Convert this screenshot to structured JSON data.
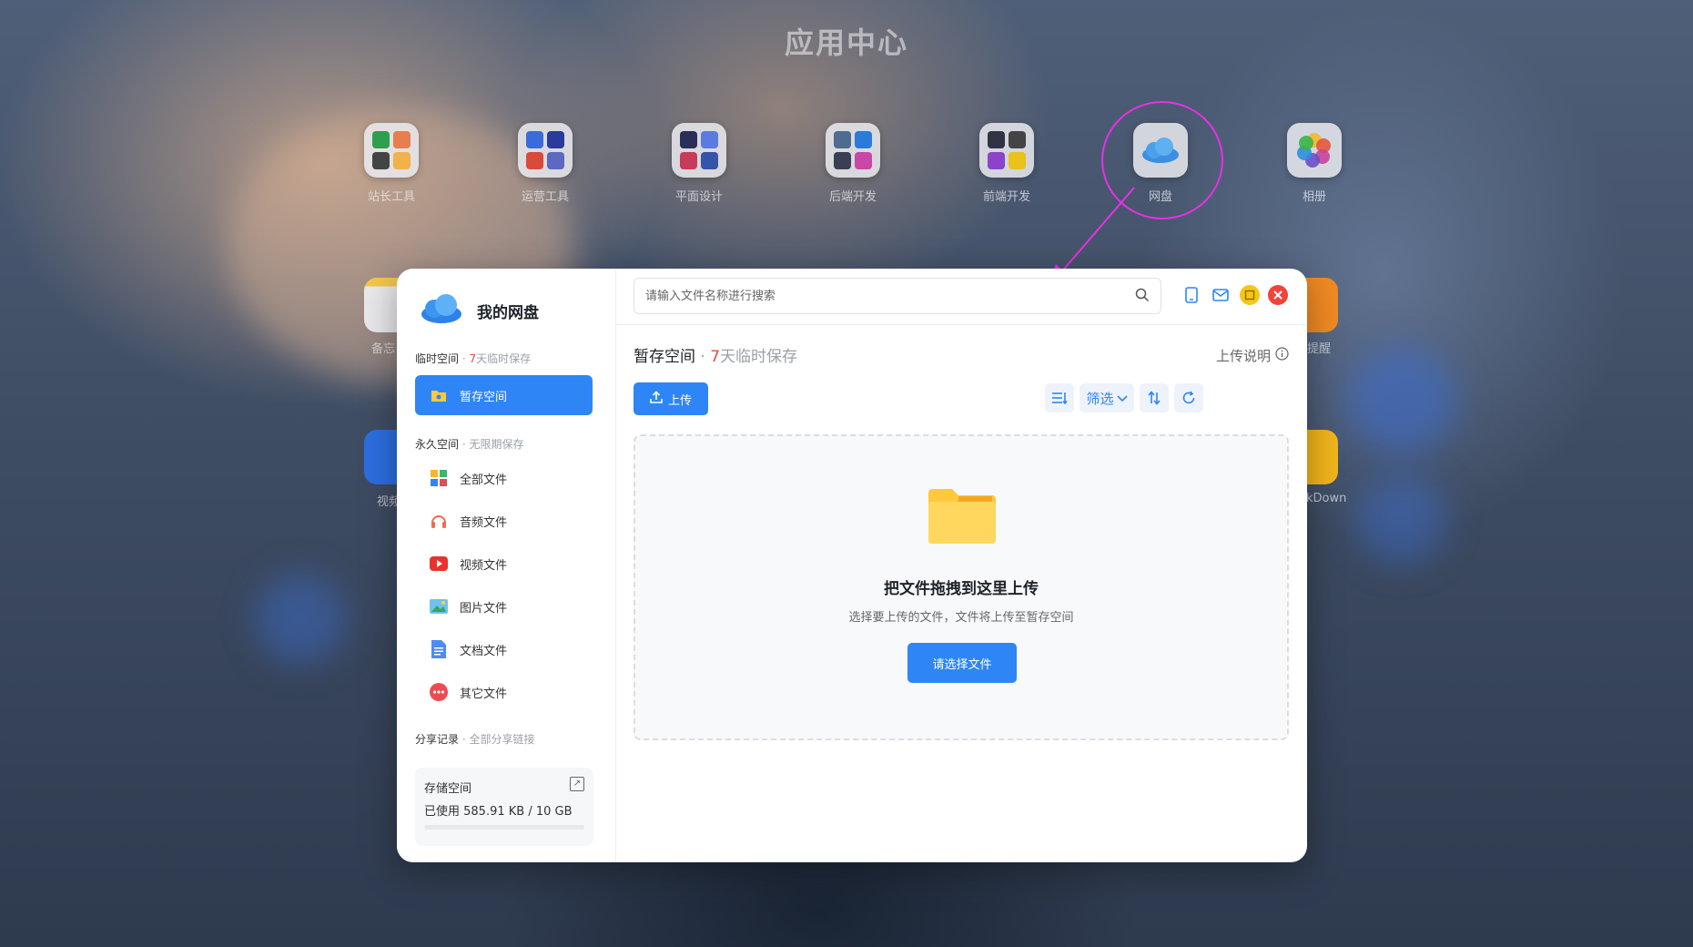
{
  "app_center": {
    "title": "应用中心",
    "apps": [
      {
        "label": "站长工具",
        "icon": "webmaster-tools-icon"
      },
      {
        "label": "运营工具",
        "icon": "operations-tools-icon"
      },
      {
        "label": "平面设计",
        "icon": "graphic-design-icon"
      },
      {
        "label": "后端开发",
        "icon": "backend-dev-icon"
      },
      {
        "label": "前端开发",
        "icon": "frontend-dev-icon"
      },
      {
        "label": "网盘",
        "icon": "cloud-drive-icon"
      },
      {
        "label": "相册",
        "icon": "photos-icon"
      }
    ],
    "partial_labels": [
      "备忘",
      "提醒",
      "视频",
      "kDown"
    ]
  },
  "sidebar": {
    "title": "我的网盘",
    "temp_section": {
      "label": "临时空间",
      "sep": " · ",
      "accent": "7",
      "sub": "天临时保存"
    },
    "active_item": {
      "label": "暂存空间",
      "icon": "folder-icon"
    },
    "perm_section": {
      "label": "永久空间",
      "sep": " · ",
      "sub": "无限期保存"
    },
    "items": [
      {
        "label": "全部文件",
        "icon": "grid-icon"
      },
      {
        "label": "音频文件",
        "icon": "headphones-icon"
      },
      {
        "label": "视频文件",
        "icon": "play-icon"
      },
      {
        "label": "图片文件",
        "icon": "image-icon"
      },
      {
        "label": "文档文件",
        "icon": "document-icon"
      },
      {
        "label": "其它文件",
        "icon": "more-icon"
      }
    ],
    "share_section": {
      "label": "分享记录",
      "sep": " · ",
      "sub": "全部分享链接"
    },
    "storage": {
      "title": "存储空间",
      "used_text": "已使用 585.91 KB / 10 GB",
      "used_fraction": 6e-05
    }
  },
  "topbar": {
    "search_placeholder": "请输入文件名称进行搜索"
  },
  "main": {
    "heading": "暂存空间",
    "heading_sep": " · ",
    "heading_accent": "7",
    "heading_sub": "天临时保存",
    "upload_help": "上传说明",
    "upload_button": "上传",
    "filter_label": "筛选",
    "dropzone": {
      "title": "把文件拖拽到这里上传",
      "subtitle": "选择要上传的文件，文件将上传至暂存空间",
      "button": "请选择文件"
    }
  },
  "colors": {
    "accent": "#2e86f6",
    "highlight": "#e74c3c",
    "annotation": "#e830e6"
  }
}
